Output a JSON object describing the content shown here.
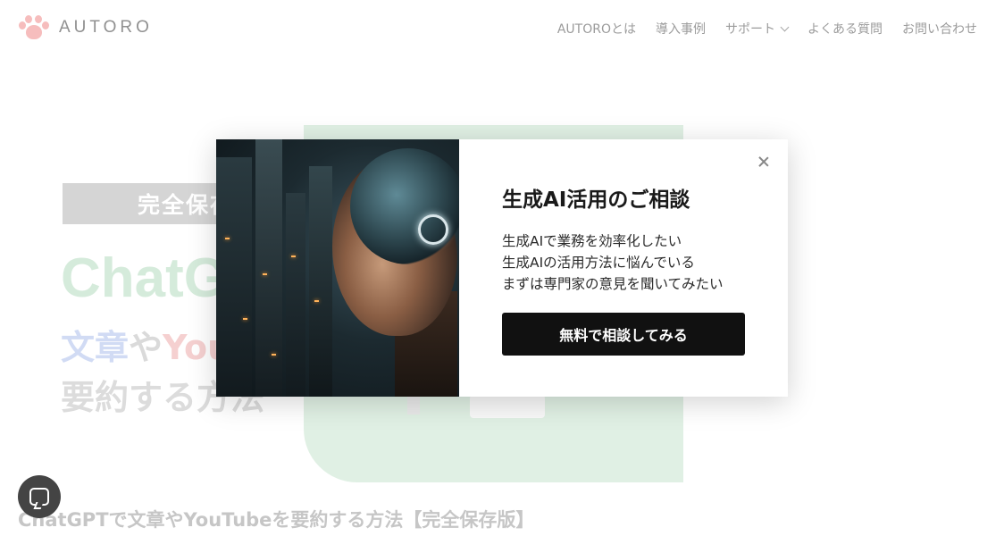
{
  "header": {
    "logo_text": "AUTORO",
    "nav": [
      {
        "label": "AUTOROとは"
      },
      {
        "label": "導入事例"
      },
      {
        "label": "サポート",
        "has_dropdown": true
      },
      {
        "label": "よくある質問"
      },
      {
        "label": "お問い合わせ"
      }
    ]
  },
  "hero": {
    "badge": "完全保存",
    "big_text": "ChatG",
    "line2": {
      "part1": "文章",
      "part2": "や",
      "part3": "You"
    },
    "line3": "要約する方法"
  },
  "article": {
    "title": "ChatGPTで文章やYouTubeを要約する方法【完全保存版】"
  },
  "modal": {
    "title": "生成AI活用のご相談",
    "lines": [
      "生成AIで業務を効率化したい",
      "生成AIの活用方法に悩んでいる",
      "まずは専門家の意見を聞いてみたい"
    ],
    "cta_label": "無料で相談してみる"
  },
  "colors": {
    "accent_paw": "#f29a9a",
    "cta_bg": "#111111",
    "hero_green": "#cfe9d6"
  },
  "icons": {
    "logo": "paw-icon",
    "close": "close-icon",
    "chat": "chat-icon",
    "dropdown": "chevron-down-icon"
  }
}
